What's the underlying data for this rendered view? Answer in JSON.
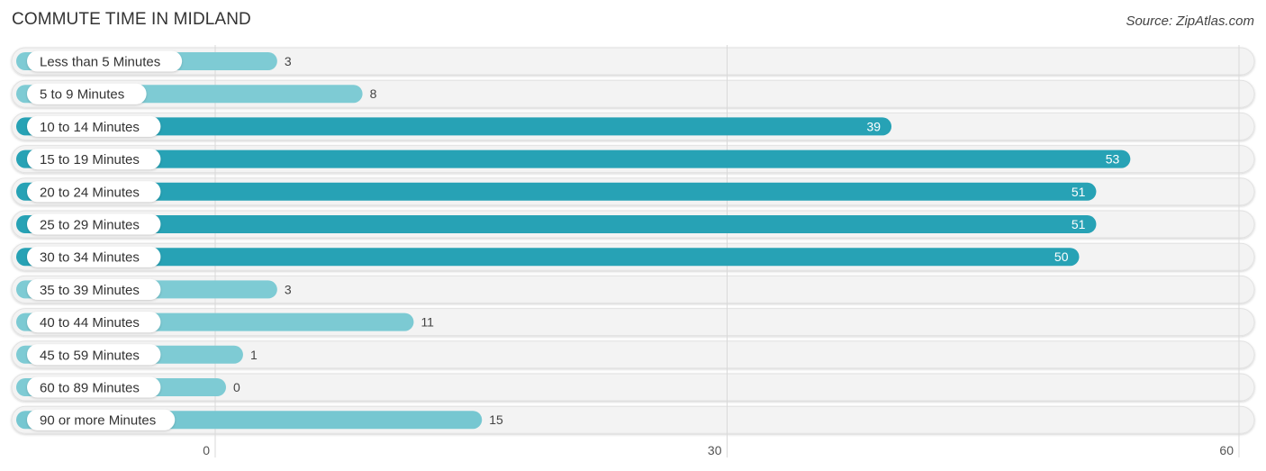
{
  "header": {
    "title": "COMMUTE TIME IN MIDLAND",
    "source": "Source: ZipAtlas.com"
  },
  "colors": {
    "bar_light": "#7ecbd4",
    "bar_dark": "#27a2b5",
    "track": "#f3f3f3",
    "grid": "#d9d9d9"
  },
  "chart_data": {
    "type": "bar",
    "orientation": "horizontal",
    "title": "COMMUTE TIME IN MIDLAND",
    "categories": [
      "Less than 5 Minutes",
      "5 to 9 Minutes",
      "10 to 14 Minutes",
      "15 to 19 Minutes",
      "20 to 24 Minutes",
      "25 to 29 Minutes",
      "30 to 34 Minutes",
      "35 to 39 Minutes",
      "40 to 44 Minutes",
      "45 to 59 Minutes",
      "60 to 89 Minutes",
      "90 or more Minutes"
    ],
    "values": [
      3,
      8,
      39,
      53,
      51,
      51,
      50,
      3,
      11,
      1,
      0,
      15
    ],
    "xlabel": "",
    "ylabel": "",
    "xlim": [
      0,
      60
    ],
    "xticks": [
      0,
      30,
      60
    ],
    "grid": true,
    "legend": "none"
  }
}
